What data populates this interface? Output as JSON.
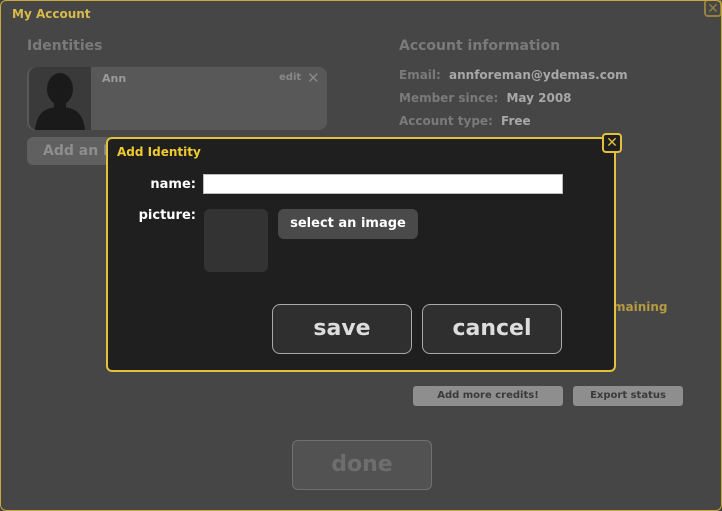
{
  "window": {
    "title": "My Account",
    "close_glyph": "✕"
  },
  "identities": {
    "heading": "Identities",
    "items": [
      {
        "name": "Ann",
        "edit_label": "edit",
        "remove_glyph": "✕"
      }
    ],
    "add_button_label": "Add an I"
  },
  "account": {
    "heading": "Account information",
    "email_label": "Email:",
    "email_value": "annforeman@ydemas.com",
    "member_since_label": "Member since:",
    "member_since_value": "May 2008",
    "account_type_label": "Account type:",
    "account_type_value": "Free",
    "credits_remaining_fragment": "maining"
  },
  "actions": {
    "add_credits_label": "Add more credits!",
    "export_status_label": "Export status",
    "done_label": "done"
  },
  "modal": {
    "title": "Add Identity",
    "close_glyph": "✕",
    "name_label": "name:",
    "name_value": "",
    "picture_label": "picture:",
    "select_image_label": "select an image",
    "save_label": "save",
    "cancel_label": "cancel"
  },
  "colors": {
    "accent_gold": "#e3c13a",
    "window_bg": "#464646",
    "modal_bg": "#1f1f1f"
  }
}
